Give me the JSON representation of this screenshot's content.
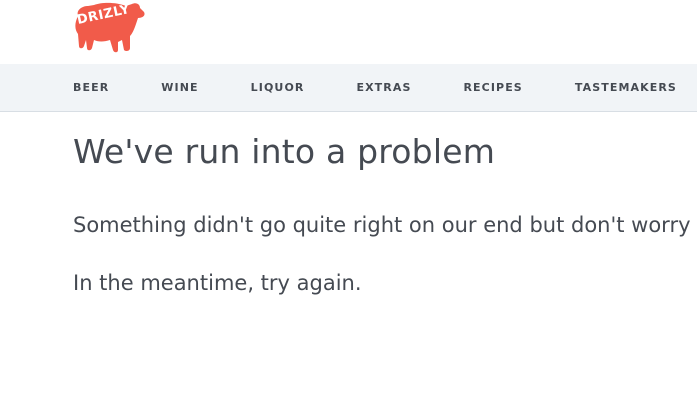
{
  "brand": {
    "logo_text": "DRIZLY",
    "logo_color": "#f15b4a"
  },
  "nav": {
    "items": [
      {
        "label": "BEER"
      },
      {
        "label": "WINE"
      },
      {
        "label": "LIQUOR"
      },
      {
        "label": "EXTRAS"
      },
      {
        "label": "RECIPES"
      },
      {
        "label": "TASTEMAKERS"
      }
    ]
  },
  "main": {
    "title": "We've run into a problem",
    "message_1": "Something didn't go quite right on our end but don't worry",
    "message_2": "In the meantime, try again."
  },
  "colors": {
    "text": "#454a52",
    "nav_bg": "#f1f4f7",
    "accent": "#f15b4a"
  }
}
